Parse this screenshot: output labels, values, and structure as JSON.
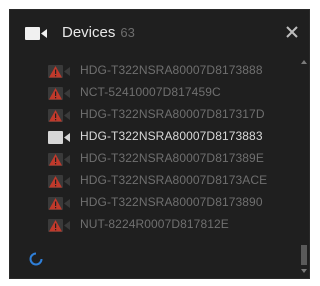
{
  "panel": {
    "title": "Devices",
    "count": "63"
  },
  "devices": [
    {
      "name": "HDG-T322NSRA80007D8173888",
      "state": "offline",
      "icon": "camera-offline-icon"
    },
    {
      "name": "NCT-52410007D817459C",
      "state": "offline",
      "icon": "camera-offline-icon"
    },
    {
      "name": "HDG-T322NSRA80007D817317D",
      "state": "offline",
      "icon": "camera-offline-icon"
    },
    {
      "name": "HDG-T322NSRA80007D8173883",
      "state": "online",
      "icon": "camera-icon"
    },
    {
      "name": "HDG-T322NSRA80007D817389E",
      "state": "offline",
      "icon": "camera-offline-icon"
    },
    {
      "name": "HDG-T322NSRA80007D8173ACE",
      "state": "offline",
      "icon": "camera-offline-icon"
    },
    {
      "name": "HDG-T322NSRA80007D8173890",
      "state": "offline",
      "icon": "camera-offline-icon"
    },
    {
      "name": "NUT-8224R0007D817812E",
      "state": "offline",
      "icon": "camera-offline-icon"
    }
  ],
  "icons": {
    "header": "camera-icon",
    "close": "close-icon",
    "loading": "loading-spinner-icon"
  },
  "colors": {
    "background": "#1f1f1f",
    "text_online": "#d9d9d9",
    "text_offline": "#6f6f6f",
    "offline_warning": "#c0392b",
    "spinner": "#2f7fd8"
  }
}
